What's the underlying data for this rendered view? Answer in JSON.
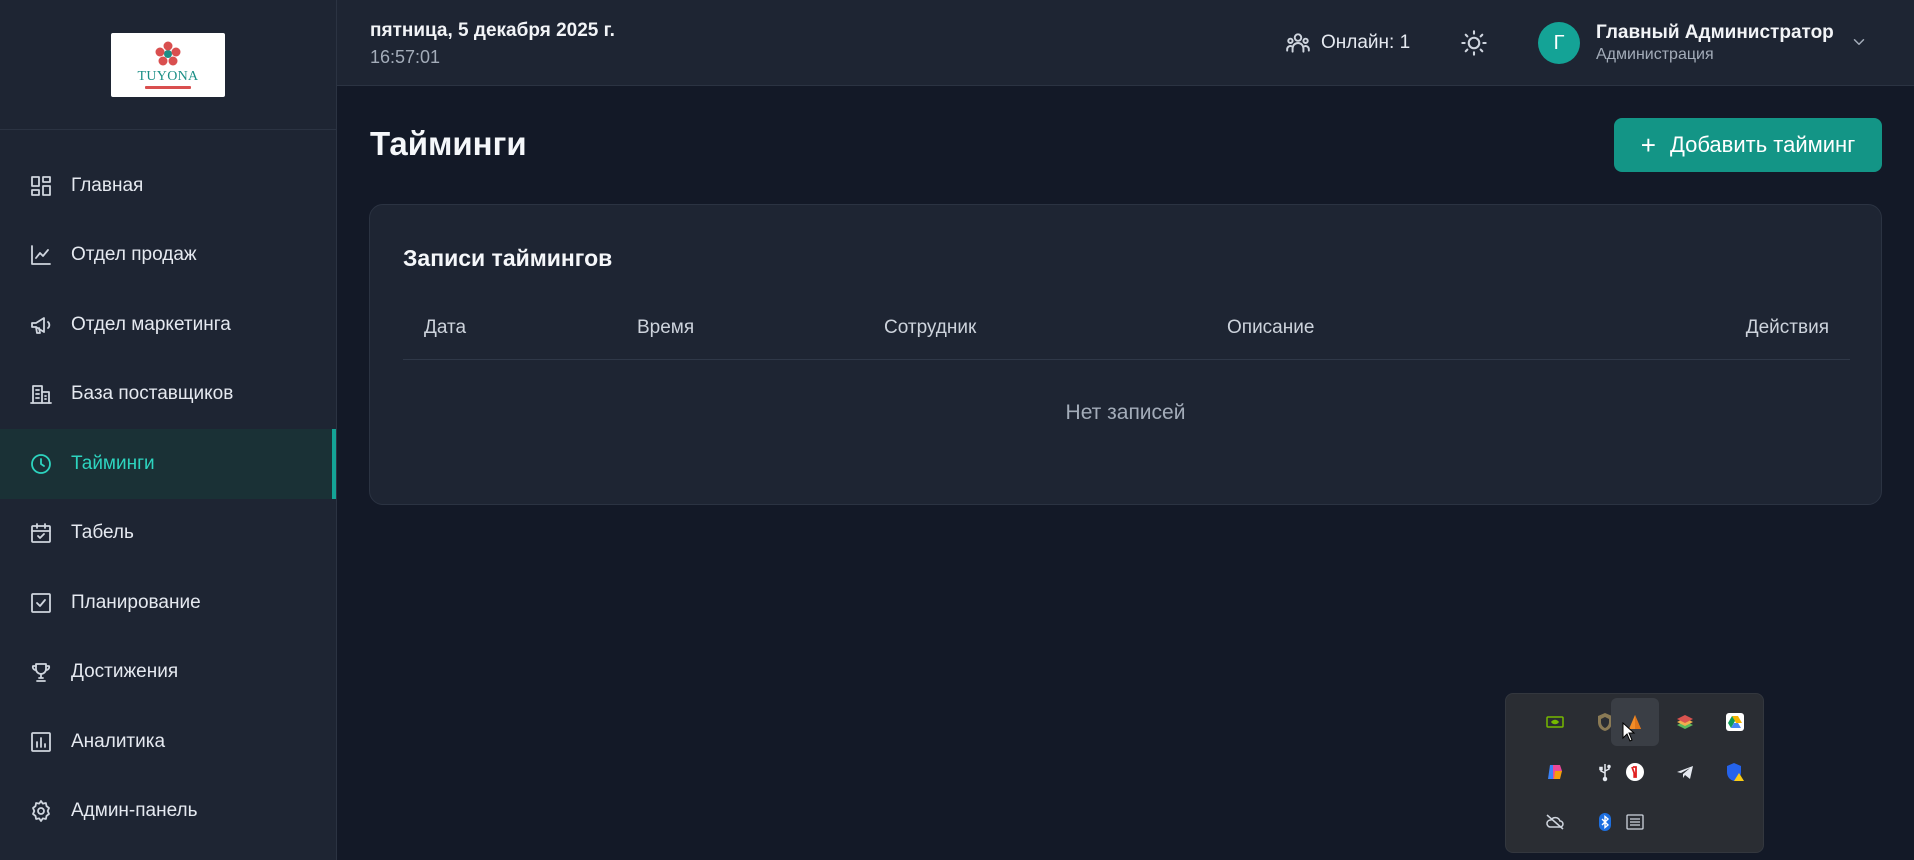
{
  "sidebar": {
    "logo_text": "TUYONA",
    "items": [
      {
        "label": "Главная",
        "icon": "dashboard-icon"
      },
      {
        "label": "Отдел продаж",
        "icon": "chart-line-icon"
      },
      {
        "label": "Отдел маркетинга",
        "icon": "megaphone-icon"
      },
      {
        "label": "База поставщиков",
        "icon": "building-icon"
      },
      {
        "label": "Тайминги",
        "icon": "clock-icon",
        "active": true
      },
      {
        "label": "Табель",
        "icon": "calendar-check-icon"
      },
      {
        "label": "Планирование",
        "icon": "checkbox-icon"
      },
      {
        "label": "Достижения",
        "icon": "trophy-icon"
      },
      {
        "label": "Аналитика",
        "icon": "bar-chart-icon"
      },
      {
        "label": "Админ-панель",
        "icon": "gear-icon"
      }
    ]
  },
  "header": {
    "date": "пятница, 5 декабря 2025 г.",
    "time": "16:57:01",
    "online": "Онлайн: 1",
    "user": {
      "initial": "Г",
      "name": "Главный Администратор",
      "role": "Администрация"
    }
  },
  "main": {
    "title": "Тайминги",
    "add_button": "Добавить тайминг",
    "card": {
      "title": "Записи таймингов",
      "columns": [
        "Дата",
        "Время",
        "Сотрудник",
        "Описание",
        "Действия"
      ],
      "empty": "Нет записей"
    }
  },
  "colors": {
    "accent": "#14a396",
    "active_text": "#2dd4bf",
    "background": "#131927",
    "panel": "#1e2533"
  },
  "tray": {
    "icons": [
      "nvidia-icon",
      "shield-app-icon",
      "orange-app-icon",
      "bluestacks-icon",
      "google-drive-icon",
      "copilot-icon",
      "usb-icon",
      "yandex-icon",
      "telegram-icon",
      "defender-warning-icon",
      "cloud-off-icon",
      "bluetooth-icon",
      "keyboard-icon"
    ]
  }
}
